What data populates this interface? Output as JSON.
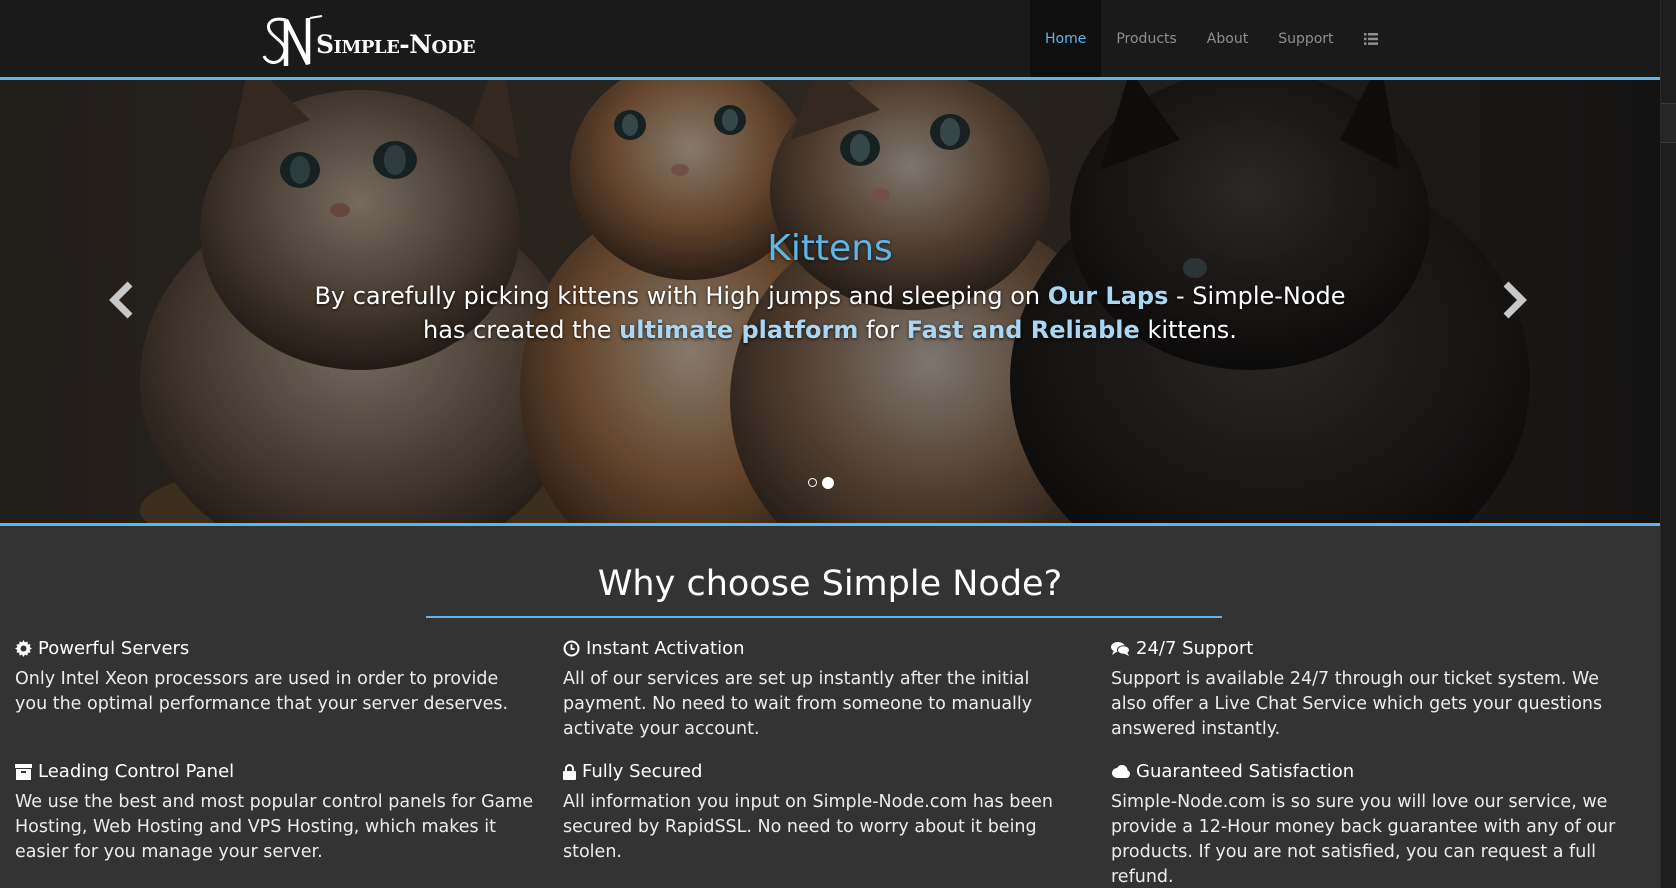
{
  "brand": {
    "name": "Simple-Node",
    "logo_letters": "SN"
  },
  "nav": {
    "items": [
      {
        "label": "Home",
        "active": true
      },
      {
        "label": "Products",
        "active": false
      },
      {
        "label": "About",
        "active": false
      },
      {
        "label": "Support",
        "active": false
      }
    ],
    "menu_icon": "list-icon"
  },
  "carousel": {
    "title": "Kittens",
    "caption_parts": [
      "By carefully picking kittens with High jumps and sleeping on ",
      "Our Laps",
      " - Simple-Node has created the ",
      "ultimate platform",
      " for ",
      "Fast and Reliable",
      " kittens."
    ],
    "prev_icon": "chevron-left-icon",
    "next_icon": "chevron-right-icon",
    "slide_count": 2,
    "active_slide": 2
  },
  "why": {
    "title": "Why choose Simple Node?",
    "features": [
      {
        "icon": "gear-icon",
        "title": "Powerful Servers",
        "text": "Only Intel Xeon processors are used in order to provide you the optimal performance that your server deserves."
      },
      {
        "icon": "clock-icon",
        "title": "Instant Activation",
        "text": "All of our services are set up instantly after the initial payment. No need to wait from someone to manually activate your account."
      },
      {
        "icon": "chat-icon",
        "title": "24/7 Support",
        "text": "Support is available 24/7 through our ticket system. We also offer a Live Chat Service which gets your questions answered instantly."
      },
      {
        "icon": "archive-icon",
        "title": "Leading Control Panel",
        "text": "We use the best and most popular control panels for Game Hosting, Web Hosting and VPS Hosting, which makes it easier for you manage your server."
      },
      {
        "icon": "lock-icon",
        "title": "Fully Secured",
        "text": "All information you input on Simple-Node.com has been secured by RapidSSL. No need to worry about it being stolen."
      },
      {
        "icon": "cloud-icon",
        "title": "Guaranteed Satisfaction",
        "text": "Simple-Node.com is so sure you will love our service, we provide a 12-Hour money back guarantee with any of our products. If you are not satisfied, you can request a full refund."
      }
    ]
  },
  "colors": {
    "accent": "#5db5e8",
    "accent_light": "#a9d6f2",
    "nav_bg": "#1a1a1a",
    "body_bg": "#333333"
  }
}
